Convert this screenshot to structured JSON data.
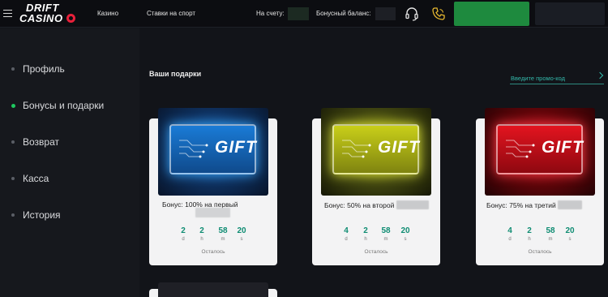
{
  "header": {
    "logo_line1": "DRIFT",
    "logo_line2": "CASINO",
    "nav": [
      "Казино",
      "Ставки на спорт"
    ],
    "balance_label": "На счету:",
    "bonus_balance_label": "Бонусный баланс:",
    "icons": [
      "menu-icon",
      "headset-icon",
      "phone-icon"
    ]
  },
  "sidebar": {
    "items": [
      {
        "label": "Профиль",
        "active": false
      },
      {
        "label": "Бонусы и подарки",
        "active": true
      },
      {
        "label": "Возврат",
        "active": false
      },
      {
        "label": "Касса",
        "active": false
      },
      {
        "label": "История",
        "active": false
      }
    ]
  },
  "main": {
    "title": "Ваши подарки",
    "promo_placeholder": "Введите промо-код",
    "cards": [
      {
        "gift_text": "GIFT",
        "color": "#1a7bd6",
        "bonus": "Бонус: 100% на первый",
        "timer": {
          "d": "2",
          "h": "2",
          "m": "58",
          "s": "20"
        },
        "left_label": "Осталось"
      },
      {
        "gift_text": "GIFT",
        "color": "#c9cf19",
        "bonus": "Бонус: 50% на второй",
        "timer": {
          "d": "4",
          "h": "2",
          "m": "58",
          "s": "20"
        },
        "left_label": "Осталось"
      },
      {
        "gift_text": "GIFT",
        "color": "#e3141f",
        "bonus": "Бонус: 75% на третий",
        "timer": {
          "d": "4",
          "h": "2",
          "m": "58",
          "s": "20"
        },
        "left_label": "Осталось"
      }
    ],
    "units": {
      "d": "d",
      "h": "h",
      "m": "m",
      "s": "s"
    }
  },
  "colors": {
    "accent_green": "#1ec95f",
    "timer_teal": "#0e8c72",
    "promo_teal": "#33b8aa"
  }
}
